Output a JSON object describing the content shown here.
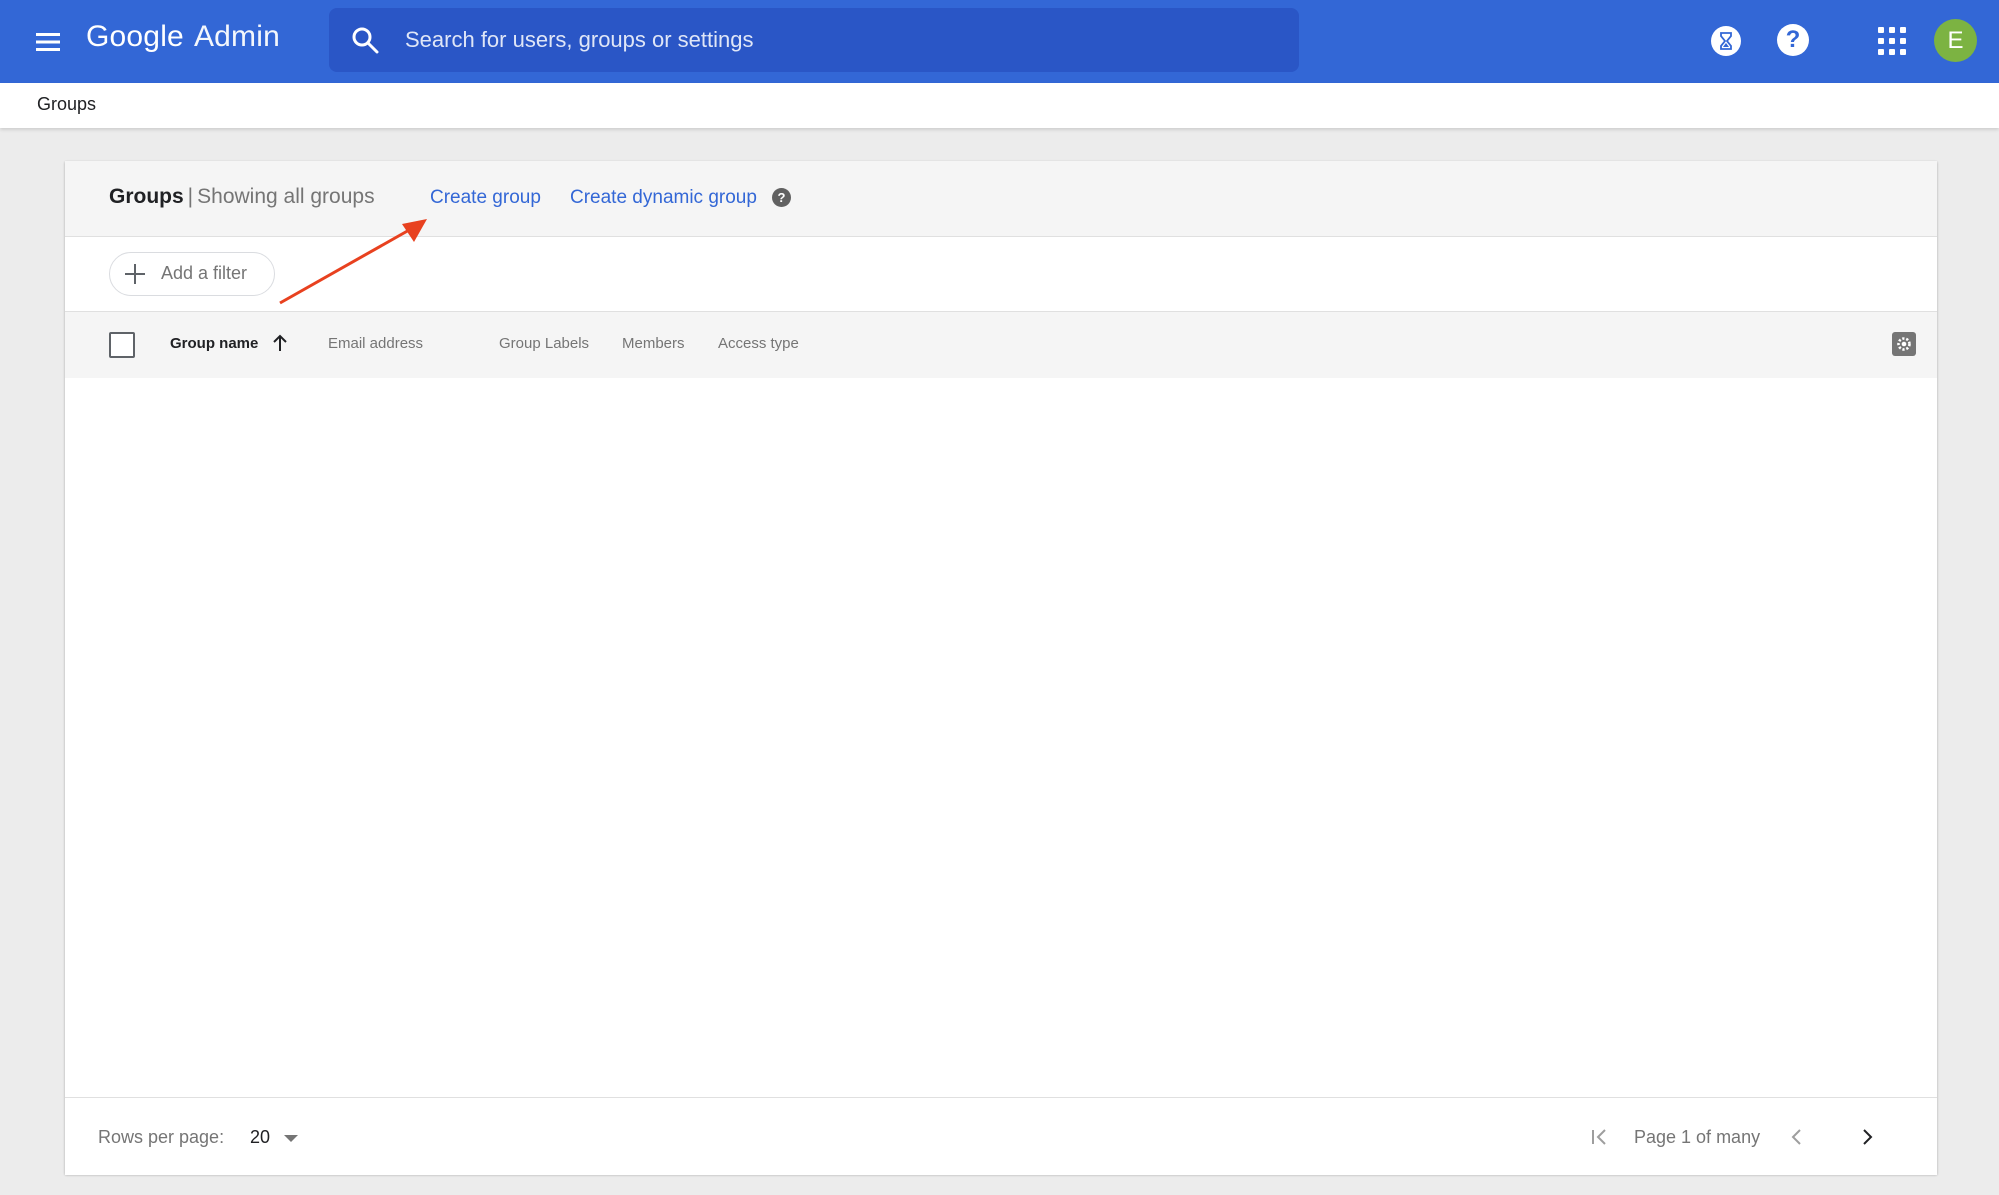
{
  "app": {
    "brand_google": "Google",
    "brand_admin": "Admin",
    "search_placeholder": "Search for users, groups or settings",
    "avatar_initial": "E",
    "help_glyph": "?",
    "icons": {
      "menu": "hamburger-menu-icon",
      "search": "search-icon",
      "tasks": "hourglass-icon",
      "help": "help-icon",
      "apps": "apps-grid-icon"
    },
    "colors": {
      "appbar": "#3367d6",
      "link": "#3367d6",
      "avatar": "#7cb342",
      "annotation_arrow": "#e8411f"
    }
  },
  "breadcrumb": {
    "label": "Groups"
  },
  "card": {
    "title": "Groups",
    "separator": "|",
    "subtitle": "Showing all groups",
    "create_group": "Create group",
    "create_dynamic_group": "Create dynamic group",
    "info_glyph": "?",
    "filter_label": "Add a filter"
  },
  "table": {
    "columns": [
      {
        "label": "Group name",
        "sorted": "ascending"
      },
      {
        "label": "Email address"
      },
      {
        "label": "Group Labels"
      },
      {
        "label": "Members"
      },
      {
        "label": "Access type"
      }
    ],
    "rows": []
  },
  "footer": {
    "rows_per_page_label": "Rows per page:",
    "rows_per_page_value": "20",
    "page_label": "Page 1 of many"
  }
}
